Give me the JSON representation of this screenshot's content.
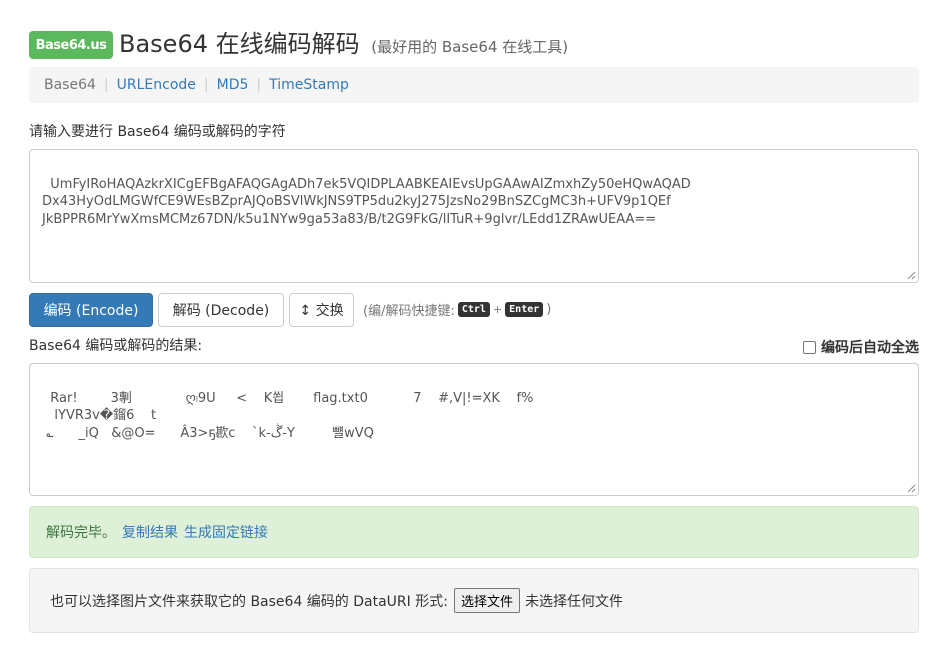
{
  "header": {
    "logo_text": "Base64.us",
    "title": "Base64 在线编码解码",
    "subtitle": "(最好用的 Base64 在线工具)"
  },
  "nav": {
    "items": [
      {
        "label": "Base64",
        "active": true
      },
      {
        "label": "URLEncode",
        "active": false
      },
      {
        "label": "MD5",
        "active": false
      },
      {
        "label": "TimeStamp",
        "active": false
      }
    ],
    "separator": "|"
  },
  "input_section": {
    "label": "请输入要进行 Base64 编码或解码的字符",
    "value": "UmFyIRoHAQAzkrXICgEFBgAFAQGAgADh7ek5VQIDPLAABKEAIEvsUpGAAwAIZmxhZy50eHQwAQAD\nDx43HyOdLMGWfCE9WEsBZprAJQoBSVlWkJNS9TP5du2kyJ275JzsNo29BnSZCgMC3h+UFV9p1QEf\nJkBPPR6MrYwXmsMCMz67DN/k5u1NYw9ga53a83/B/t2G9FkG/lITuR+9glvr/LEdd1ZRAwUEAA=="
  },
  "actions": {
    "encode_label": "编码 (Encode)",
    "decode_label": "解码 (Decode)",
    "swap_label": "↕ 交换",
    "hint_prefix": "(编/解码快捷键:",
    "hint_key1": "Ctrl",
    "hint_plus": "+",
    "hint_key2": "Enter",
    "hint_suffix": ")"
  },
  "output_section": {
    "label": "Base64 编码或解码的结果:",
    "auto_select_label": "编码后自动全选",
    "auto_select_checked": false,
    "value": "Rar!        3剸             ღ၊9U     <    K쐽       flag.txt0           7    #,V|!=XK    f%\n   lYVR3v�鎦6    t\n ؎      _iQ   &@O=      Â3>ҕ歁c    `k-ڴ-Y         뺼wVQ"
  },
  "status": {
    "message": "解码完毕。",
    "copy_link": "复制结果",
    "permalink": "生成固定链接"
  },
  "file_section": {
    "label": "也可以选择图片文件来获取它的 Base64 编码的 DataURI 形式:",
    "button_label": "选择文件",
    "no_file_text": "未选择任何文件"
  },
  "colors": {
    "brand_green": "#5cb85c",
    "primary_blue": "#337ab7",
    "success_bg": "#dff0d8"
  }
}
